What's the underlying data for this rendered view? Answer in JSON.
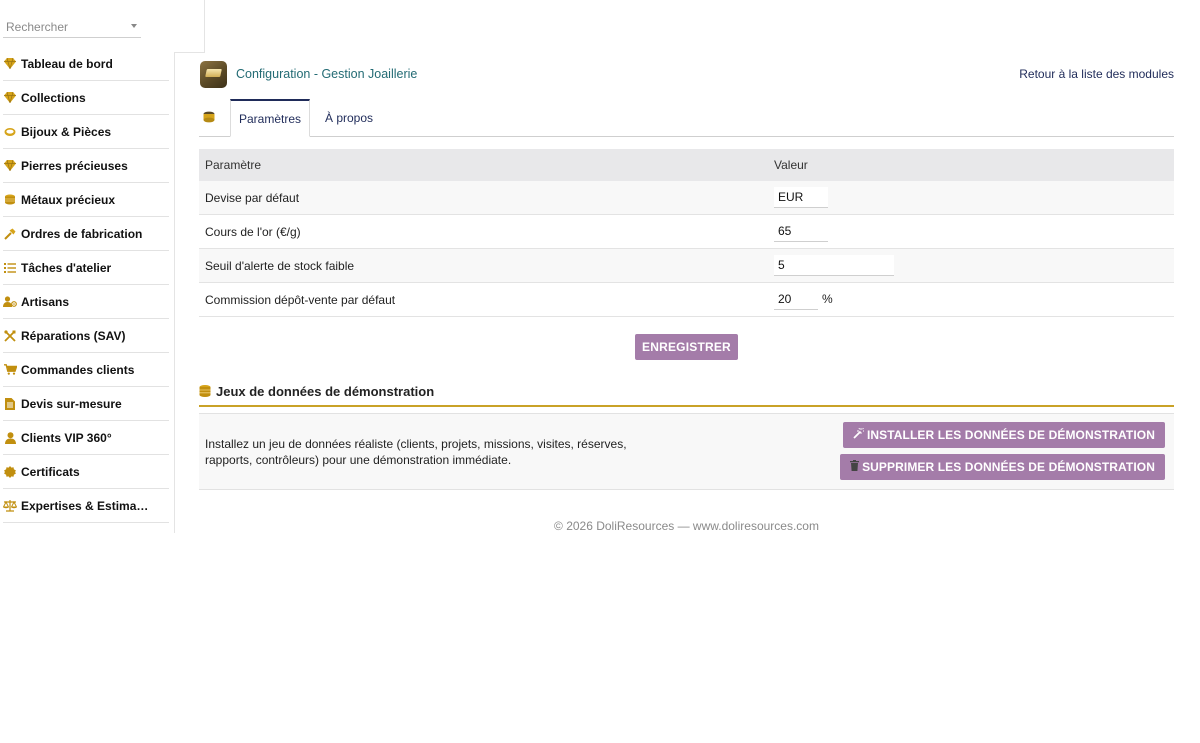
{
  "search": {
    "placeholder": "Rechercher"
  },
  "menu": [
    {
      "label": "Tableau de bord",
      "icon": "diamond-icon"
    },
    {
      "label": "Collections",
      "icon": "diamond-icon"
    },
    {
      "label": "Bijoux & Pièces",
      "icon": "ring-icon"
    },
    {
      "label": "Pierres précieuses",
      "icon": "diamond-icon"
    },
    {
      "label": "Métaux précieux",
      "icon": "coins-icon"
    },
    {
      "label": "Ordres de fabrication",
      "icon": "hammer-icon"
    },
    {
      "label": "Tâches d'atelier",
      "icon": "list-icon"
    },
    {
      "label": "Artisans",
      "icon": "users-gear-icon"
    },
    {
      "label": "Réparations (SAV)",
      "icon": "tools-icon"
    },
    {
      "label": "Commandes clients",
      "icon": "cart-icon"
    },
    {
      "label": "Devis sur-mesure",
      "icon": "document-icon"
    },
    {
      "label": "Clients VIP 360°",
      "icon": "user-icon"
    },
    {
      "label": "Certificats",
      "icon": "certificate-icon"
    },
    {
      "label": "Expertises & Estimat…",
      "icon": "scale-icon"
    }
  ],
  "header": {
    "title": "Configuration - Gestion Joaillerie",
    "back_link": "Retour à la liste des modules"
  },
  "tabs": [
    {
      "label": "Paramètres",
      "active": true
    },
    {
      "label": "À propos",
      "active": false
    }
  ],
  "params": {
    "headers": [
      "Paramètre",
      "Valeur"
    ],
    "rows": [
      {
        "label": "Devise par défaut",
        "value": "EUR",
        "unit": ""
      },
      {
        "label": "Cours de l'or (€/g)",
        "value": "65",
        "unit": ""
      },
      {
        "label": "Seuil d'alerte de stock faible",
        "value": "5",
        "unit": ""
      },
      {
        "label": "Commission dépôt-vente par défaut",
        "value": "20",
        "unit": "%"
      }
    ],
    "save_label": "ENREGISTRER"
  },
  "demo": {
    "title": "Jeux de données de démonstration",
    "description": "Installez un jeu de données réaliste (clients, projets, missions, visites, réserves, rapports, contrôleurs) pour une démonstration immédiate.",
    "install_label": "INSTALLER LES DONNÉES DE DÉMONSTRATION",
    "delete_label": "SUPPRIMER LES DONNÉES DE DÉMONSTRATION"
  },
  "footer": {
    "text": "© 2026 DoliResources — www.doliresources.com"
  },
  "colors": {
    "accent_button": "#a47ca9",
    "title_teal": "#236b74",
    "link_navy": "#1f2b59",
    "gold": "#c79a0d",
    "section_rule": "#c9a227"
  }
}
